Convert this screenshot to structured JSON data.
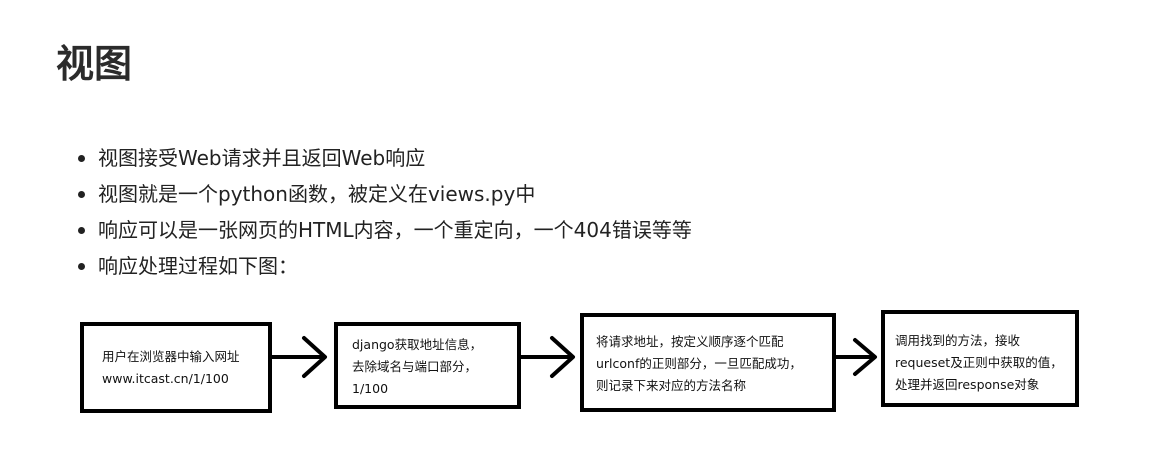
{
  "page": {
    "title": "视图"
  },
  "bullets": [
    "视图接受Web请求并且返回Web响应",
    "视图就是一个python函数，被定义在views.py中",
    "响应可以是一张网页的HTML内容，一个重定向，一个404错误等等",
    "响应处理过程如下图："
  ],
  "flow": {
    "steps": [
      {
        "lines": [
          "用户在浏览器中输入网址",
          "www.itcast.cn/1/100"
        ]
      },
      {
        "lines": [
          "django获取地址信息，",
          "去除域名与端口部分，",
          "1/100"
        ]
      },
      {
        "lines": [
          "将请求地址，按定义顺序逐个匹配",
          "urlconf的正则部分，一旦匹配成功，",
          "则记录下来对应的方法名称"
        ]
      },
      {
        "lines": [
          "调用找到的方法，接收",
          "requeset及正则中获取的值，",
          "处理并返回response对象"
        ]
      }
    ],
    "arrow_color": "#000000"
  }
}
